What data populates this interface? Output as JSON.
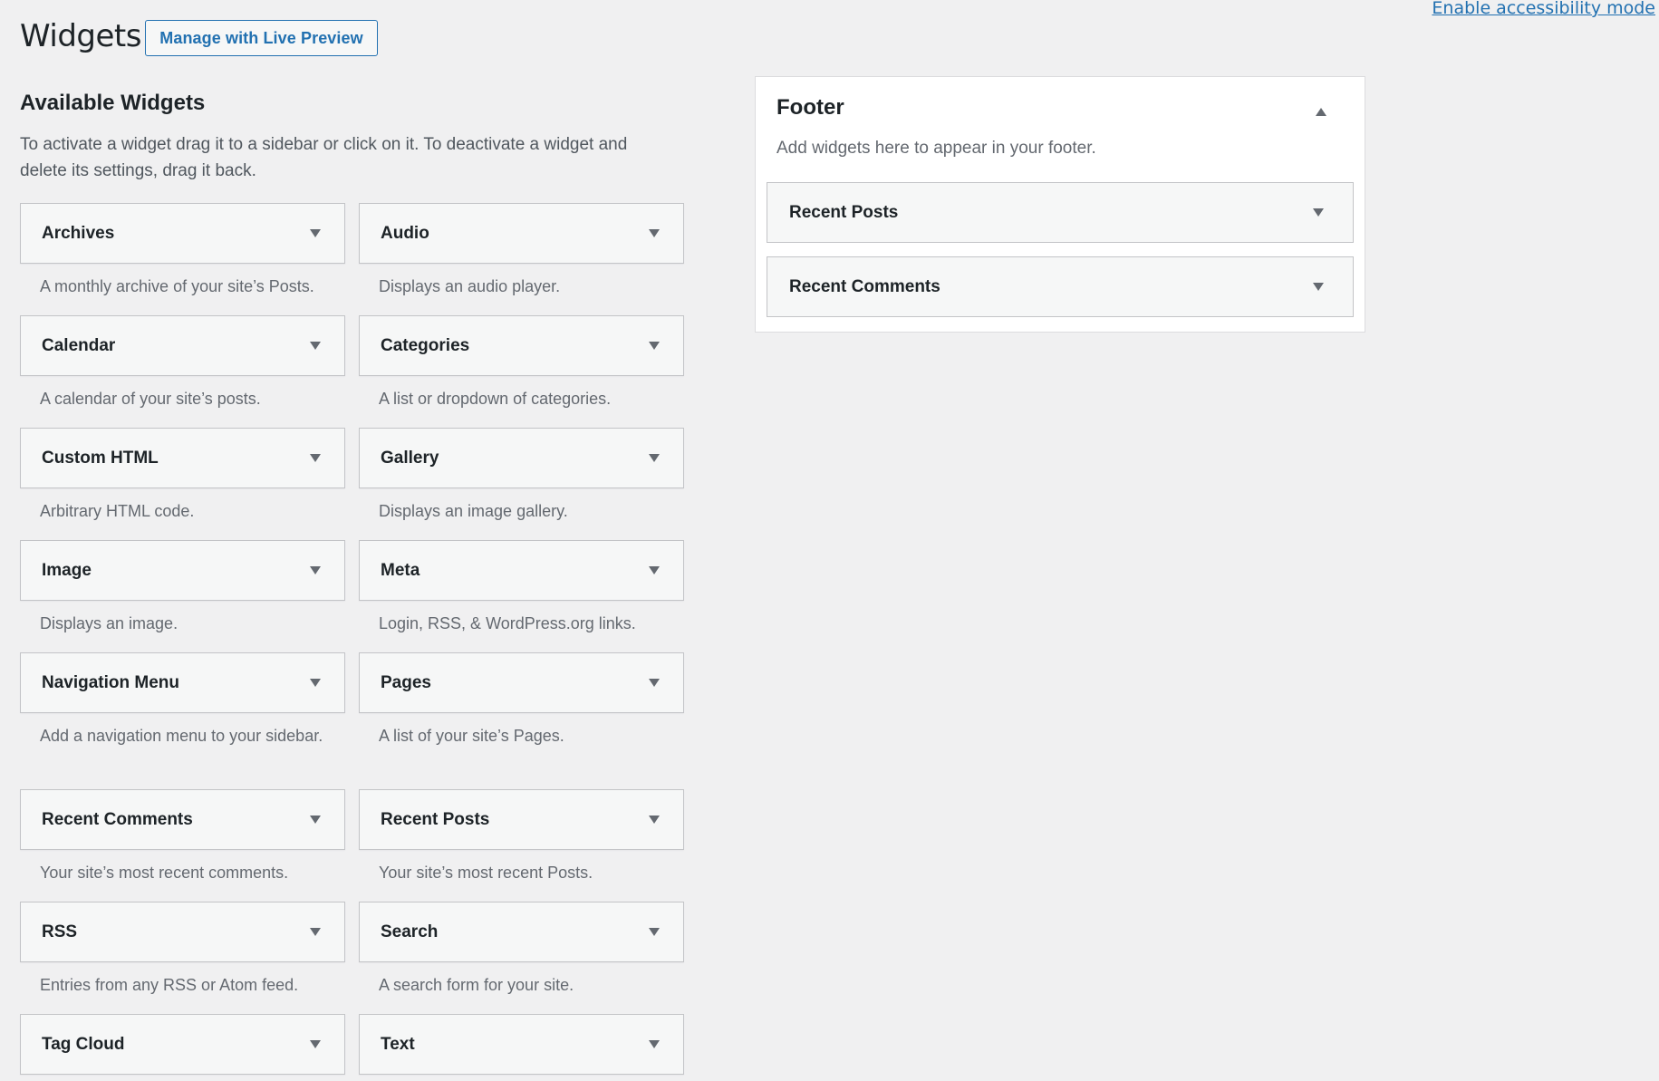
{
  "header": {
    "title": "Widgets",
    "live_preview_label": "Manage with Live Preview",
    "accessibility_link": "Enable accessibility mode"
  },
  "available": {
    "title": "Available Widgets",
    "description": "To activate a widget drag it to a sidebar or click on it. To deactivate a widget and delete its settings, drag it back.",
    "widgets": [
      {
        "title": "Archives",
        "desc": "A monthly archive of your site’s Posts.",
        "icon": "chevron-down-icon"
      },
      {
        "title": "Audio",
        "desc": "Displays an audio player.",
        "icon": "chevron-down-icon"
      },
      {
        "title": "Calendar",
        "desc": "A calendar of your site’s posts.",
        "icon": "chevron-down-icon"
      },
      {
        "title": "Categories",
        "desc": "A list or dropdown of categories.",
        "icon": "chevron-down-icon"
      },
      {
        "title": "Custom HTML",
        "desc": "Arbitrary HTML code.",
        "icon": "chevron-down-icon"
      },
      {
        "title": "Gallery",
        "desc": "Displays an image gallery.",
        "icon": "chevron-down-icon"
      },
      {
        "title": "Image",
        "desc": "Displays an image.",
        "icon": "chevron-down-icon"
      },
      {
        "title": "Meta",
        "desc": "Login, RSS, & WordPress.org links.",
        "icon": "chevron-down-icon"
      },
      {
        "title": "Navigation Menu",
        "desc": "Add a navigation menu to your sidebar.",
        "icon": "chevron-down-icon"
      },
      {
        "title": "Pages",
        "desc": "A list of your site’s Pages.",
        "icon": "chevron-down-icon"
      },
      {
        "title": "Recent Comments",
        "desc": "Your site’s most recent comments.",
        "icon": "chevron-down-icon"
      },
      {
        "title": "Recent Posts",
        "desc": "Your site’s most recent Posts.",
        "icon": "chevron-down-icon"
      },
      {
        "title": "RSS",
        "desc": "Entries from any RSS or Atom feed.",
        "icon": "chevron-down-icon"
      },
      {
        "title": "Search",
        "desc": "A search form for your site.",
        "icon": "chevron-down-icon"
      },
      {
        "title": "Tag Cloud",
        "desc": "",
        "icon": "chevron-down-icon"
      },
      {
        "title": "Text",
        "desc": "",
        "icon": "chevron-down-icon"
      }
    ]
  },
  "footer_area": {
    "title": "Footer",
    "description": "Add widgets here to appear in your footer.",
    "toggle_icon": "chevron-up-icon",
    "widgets": [
      {
        "title": "Recent Posts"
      },
      {
        "title": "Recent Comments"
      }
    ]
  },
  "colors": {
    "accent": "#2271b1",
    "background": "#f0f0f1",
    "widget_bg": "#f6f7f7",
    "border": "#c3c4c7"
  }
}
